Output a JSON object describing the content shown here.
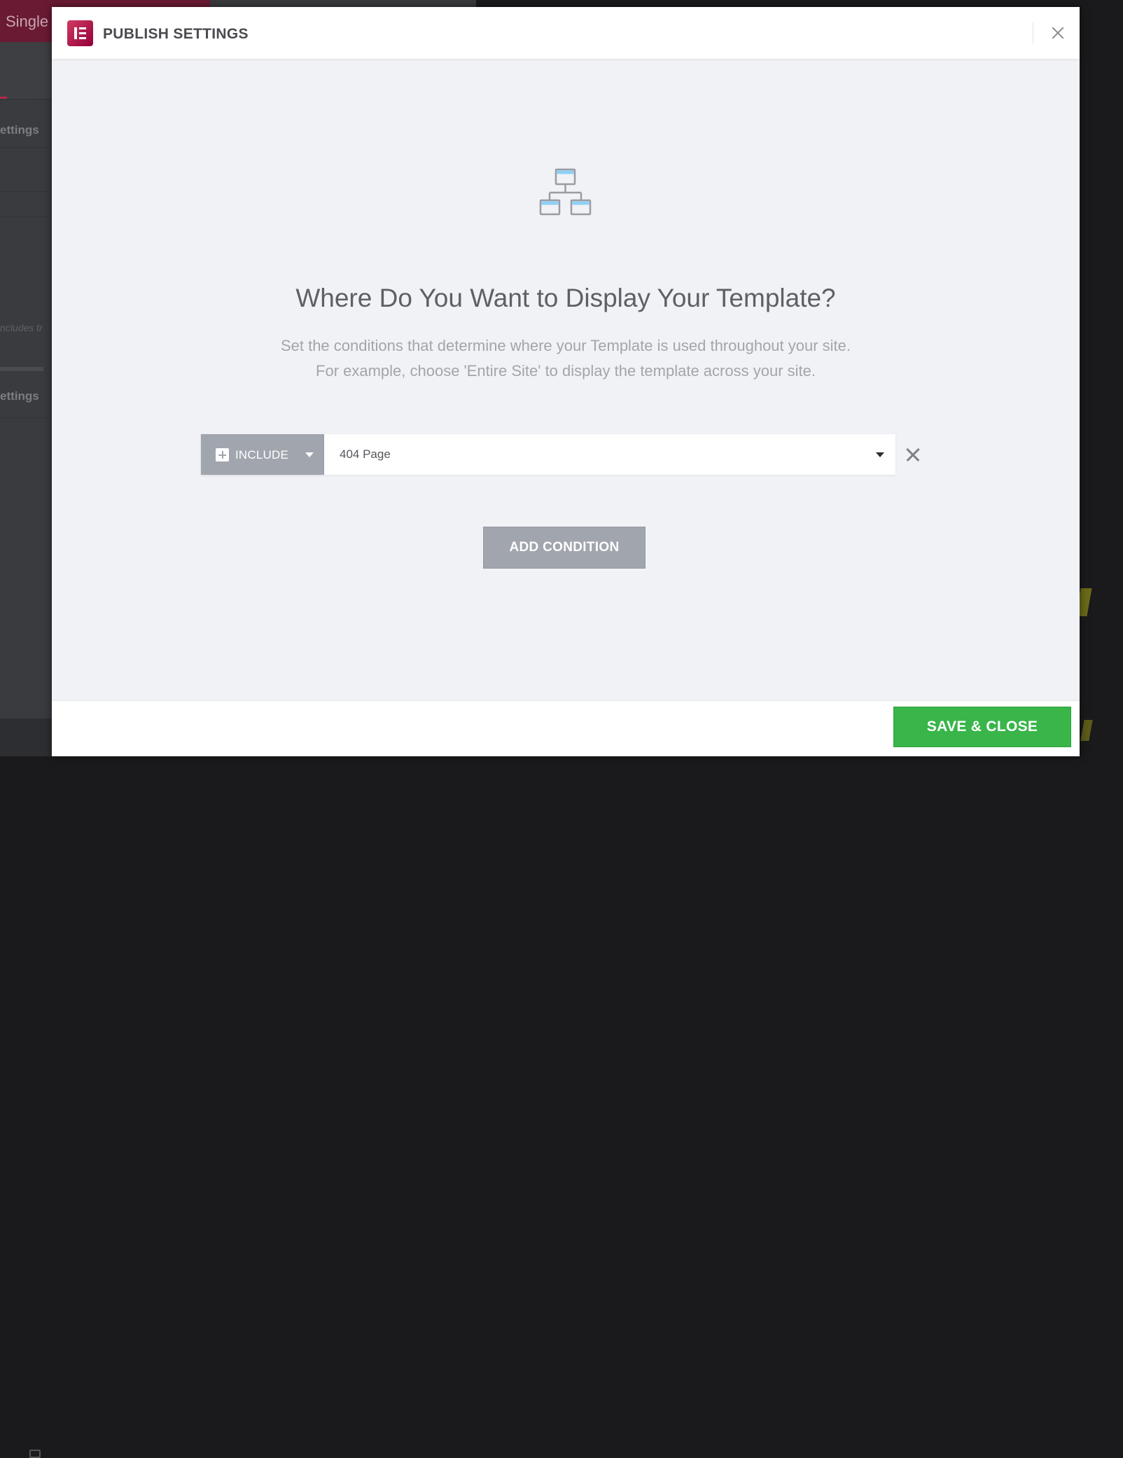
{
  "background": {
    "template_type": "Single",
    "section_1": "ettings",
    "section_2": "ettings",
    "hint": "ncludes tr"
  },
  "modal": {
    "title": "PUBLISH SETTINGS",
    "heading": "Where Do You Want to Display Your Template?",
    "description_line1": "Set the conditions that determine where your Template is used throughout your site.",
    "description_line2": "For example, choose 'Entire Site' to display the template across your site.",
    "condition": {
      "type": "INCLUDE",
      "value": "404 Page"
    },
    "add_condition_label": "ADD CONDITION",
    "save_label": "SAVE & CLOSE"
  },
  "colors": {
    "brand": "#d23a61",
    "save": "#39b54a",
    "include": "#a1a5ae",
    "icon_accent": "#8ed0f5"
  }
}
